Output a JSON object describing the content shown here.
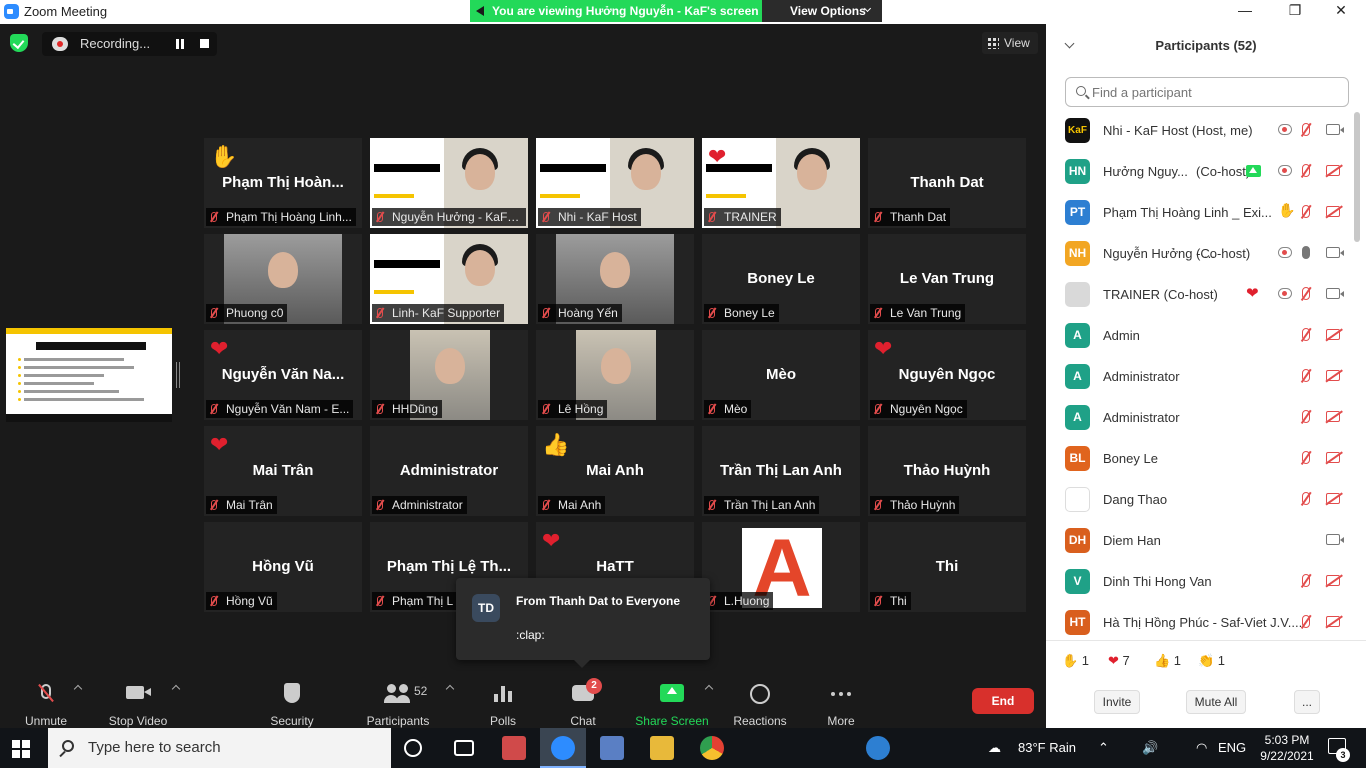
{
  "window": {
    "title": "Zoom Meeting",
    "viewing_banner": "You are viewing Hưởng Nguyễn - KaF's screen",
    "view_options": "View Options",
    "min_glyph": "—",
    "max_glyph": "❐",
    "close_glyph": "✕"
  },
  "recording": {
    "label": "Recording..."
  },
  "view_button": {
    "label": "View"
  },
  "tiles": [
    {
      "name": "Phạm Thị Hoàn...",
      "label": "Phạm Thị Hoàng Linh...",
      "reaction": "✋",
      "kind": "name"
    },
    {
      "name": "",
      "label": "Nguyễn Hưởng - KaF Ed...",
      "reaction": "",
      "kind": "video-slide",
      "active": true
    },
    {
      "name": "",
      "label": "Nhi - KaF Host",
      "reaction": "",
      "kind": "video-slide"
    },
    {
      "name": "",
      "label": "TRAINER",
      "reaction": "❤",
      "kind": "video-slide"
    },
    {
      "name": "Thanh Dat",
      "label": "Thanh Dat",
      "reaction": "",
      "kind": "name"
    },
    {
      "name": "",
      "label": "Phuong c0",
      "reaction": "",
      "kind": "video"
    },
    {
      "name": "",
      "label": "Linh- KaF Supporter",
      "reaction": "",
      "kind": "video-slide"
    },
    {
      "name": "",
      "label": "Hoàng Yến",
      "reaction": "",
      "kind": "video"
    },
    {
      "name": "Boney Le",
      "label": "Boney Le",
      "reaction": "",
      "kind": "name"
    },
    {
      "name": "Le Van Trung",
      "label": "Le Van Trung",
      "reaction": "",
      "kind": "name"
    },
    {
      "name": "Nguyễn Văn Na...",
      "label": "Nguyễn Văn Nam - E...",
      "reaction": "❤",
      "kind": "name"
    },
    {
      "name": "",
      "label": "HHDũng",
      "reaction": "",
      "kind": "video-photo"
    },
    {
      "name": "",
      "label": "Lê Hồng",
      "reaction": "",
      "kind": "video-photo"
    },
    {
      "name": "Mèo",
      "label": "Mèo",
      "reaction": "",
      "kind": "name"
    },
    {
      "name": "Nguyên Ngọc",
      "label": "Nguyên Ngọc",
      "reaction": "❤",
      "kind": "name"
    },
    {
      "name": "Mai Trân",
      "label": "Mai Trân",
      "reaction": "❤",
      "kind": "name"
    },
    {
      "name": "Administrator",
      "label": "Administrator",
      "reaction": "",
      "kind": "name"
    },
    {
      "name": "Mai Anh",
      "label": "Mai Anh",
      "reaction": "👍",
      "kind": "name"
    },
    {
      "name": "Trần Thị Lan Anh",
      "label": "Trần Thị Lan Anh",
      "reaction": "",
      "kind": "name"
    },
    {
      "name": "Thảo Huỳnh",
      "label": "Thảo Huỳnh",
      "reaction": "",
      "kind": "name"
    },
    {
      "name": "Hồng Vũ",
      "label": "Hồng Vũ",
      "reaction": "",
      "kind": "name"
    },
    {
      "name": "Phạm Thị Lệ Th...",
      "label": "Phạm Thị L",
      "reaction": "",
      "kind": "name"
    },
    {
      "name": "HaTT",
      "label": "",
      "reaction": "❤",
      "kind": "name"
    },
    {
      "name": "",
      "label": "L.Huong",
      "reaction": "",
      "kind": "letter-a"
    },
    {
      "name": "Thi",
      "label": "Thi",
      "reaction": "",
      "kind": "name"
    }
  ],
  "letter_tile_glyph": "A",
  "chat_toast": {
    "avatar": "TD",
    "from": "From Thanh Dat to Everyone",
    "message": ":clap:"
  },
  "toolbar": {
    "unmute": "Unmute",
    "stop_video": "Stop Video",
    "security": "Security",
    "participants": "Participants",
    "participants_count": "52",
    "polls": "Polls",
    "chat": "Chat",
    "chat_badge": "2",
    "share_screen": "Share Screen",
    "reactions": "Reactions",
    "more": "More",
    "end": "End"
  },
  "panel": {
    "title": "Participants (52)",
    "search_placeholder": "Find a participant",
    "participants": [
      {
        "initials": "KaF",
        "color": "#111111",
        "name": "Nhi - KaF Host (Host, me)",
        "extra": "",
        "icons": [
          "rec",
          "mic-off",
          "cam-on"
        ]
      },
      {
        "initials": "HN",
        "color": "#1fa187",
        "name": "Hưởng Nguy...",
        "extra": "(Co-host)",
        "icons": [
          "share",
          "rec",
          "mic-off",
          "cam-off"
        ]
      },
      {
        "initials": "PT",
        "color": "#2d7fd2",
        "name": "Phạm Thị Hoàng Linh _ Exi...",
        "extra": "",
        "icons": [
          "hand",
          "mic-off",
          "cam-off"
        ]
      },
      {
        "initials": "NH",
        "color": "#f2a623",
        "name": "Nguyễn Hưởng - ...",
        "extra": "(Co-host)",
        "icons": [
          "rec",
          "mic-on",
          "cam-on"
        ]
      },
      {
        "initials": "",
        "color": "#d9d9d9",
        "name": "TRAINER (Co-host)",
        "extra": "",
        "icons": [
          "heart",
          "rec",
          "mic-off",
          "cam-on"
        ]
      },
      {
        "initials": "A",
        "color": "#1fa187",
        "name": "Admin",
        "extra": "",
        "icons": [
          "mic-off",
          "cam-off"
        ]
      },
      {
        "initials": "A",
        "color": "#1fa187",
        "name": "Administrator",
        "extra": "",
        "icons": [
          "mic-off",
          "cam-off"
        ]
      },
      {
        "initials": "A",
        "color": "#1fa187",
        "name": "Administrator",
        "extra": "",
        "icons": [
          "mic-off",
          "cam-off"
        ]
      },
      {
        "initials": "BL",
        "color": "#e0641e",
        "name": "Boney Le",
        "extra": "",
        "icons": [
          "mic-off",
          "cam-off"
        ]
      },
      {
        "initials": "",
        "color": "#ffffff",
        "name": "Dang Thao",
        "extra": "",
        "icons": [
          "mic-off",
          "cam-off"
        ]
      },
      {
        "initials": "DH",
        "color": "#d95f1e",
        "name": "Diem Han",
        "extra": "",
        "icons": [
          "cam-on"
        ]
      },
      {
        "initials": "V",
        "color": "#1fa187",
        "name": "Dinh Thi Hong Van",
        "extra": "",
        "icons": [
          "mic-off",
          "cam-off"
        ]
      },
      {
        "initials": "HT",
        "color": "#d95f1e",
        "name": "Hà Thị Hồng Phúc - Saf-Viet J.V....",
        "extra": "",
        "icons": [
          "mic-off",
          "cam-off"
        ]
      }
    ],
    "reactions": [
      {
        "emoji": "✋",
        "count": "1"
      },
      {
        "emoji": "❤",
        "count": "7"
      },
      {
        "emoji": "👍",
        "count": "1"
      },
      {
        "emoji": "👏",
        "count": "1"
      }
    ],
    "invite": "Invite",
    "mute_all": "Mute All",
    "more": "..."
  },
  "taskbar": {
    "search_placeholder": "Type here to search",
    "weather": "83°F  Rain",
    "language": "ENG",
    "time": "5:03 PM",
    "date": "9/22/2021",
    "notification_count": "3"
  },
  "colors": {
    "accent_green": "#23d959",
    "mute_red": "#e24c4c",
    "end_red": "#d8302c",
    "zoom_blue": "#2D8CFF"
  }
}
